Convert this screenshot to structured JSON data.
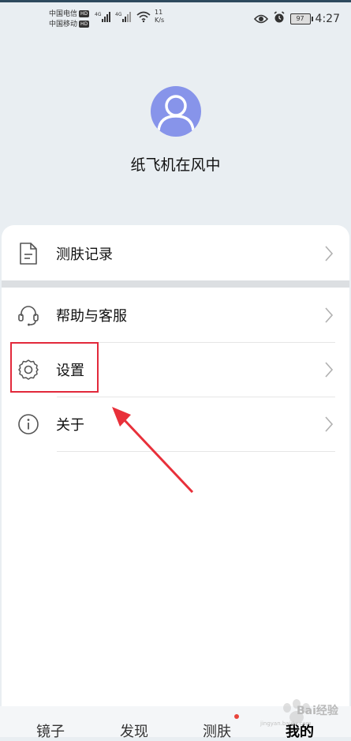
{
  "status_bar": {
    "carrier1": "中国电信",
    "carrier2": "中国移动",
    "hd_badge": "HD",
    "network1": "4G",
    "network2": "4G",
    "speed_value": "11",
    "speed_unit": "K/s",
    "battery": "97",
    "time": "4:27",
    "icons": [
      "eye-icon",
      "alarm-icon"
    ]
  },
  "profile": {
    "username": "纸飞机在风中"
  },
  "menu": {
    "items": [
      {
        "label": "测肤记录",
        "icon": "document-icon"
      },
      {
        "label": "帮助与客服",
        "icon": "headset-icon"
      },
      {
        "label": "设置",
        "icon": "gear-icon"
      },
      {
        "label": "关于",
        "icon": "info-icon"
      }
    ]
  },
  "bottom_nav": {
    "items": [
      "镜子",
      "发现",
      "测肤",
      "我的"
    ],
    "active": "我的",
    "badge_on": "测肤"
  },
  "watermark": {
    "text": "Bai经验",
    "sub": "jingyan.baidu.com"
  },
  "colors": {
    "avatar": "#8794ea",
    "highlight": "#e2293b",
    "arrow": "#e8303a",
    "badge_dot": "#e8453c"
  }
}
